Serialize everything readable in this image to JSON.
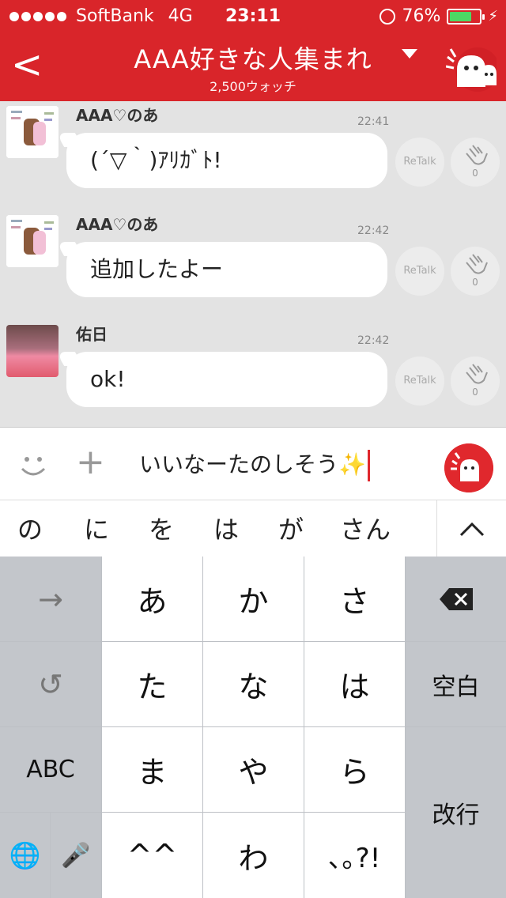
{
  "status": {
    "carrier": "SoftBank",
    "network": "4G",
    "time": "23:11",
    "battery": "76%",
    "battery_level": 0.76
  },
  "header": {
    "back_glyph": "<",
    "title": "AAA好きな人集まれ",
    "subtitle": "2,500ウォッチ"
  },
  "messages": [
    {
      "sender": "AAA♡のあ",
      "time": "22:41",
      "text": "(´▽｀)ｱﾘｶﾞﾄ!",
      "retalk": "ReTalk",
      "claps": "0"
    },
    {
      "sender": "AAA♡のあ",
      "time": "22:42",
      "text": "追加したよー",
      "retalk": "ReTalk",
      "claps": "0"
    },
    {
      "sender": "佑日",
      "time": "22:42",
      "text": "ok!",
      "retalk": "ReTalk",
      "claps": "0"
    }
  ],
  "input": {
    "text": "いいなーたのしそう✨",
    "plus_glyph": "+"
  },
  "candidates": [
    "の",
    "に",
    "を",
    "は",
    "が",
    "さん"
  ],
  "keyboard": {
    "row1": [
      "→",
      "あ",
      "か",
      "さ",
      "⌫"
    ],
    "row2": [
      "↺",
      "た",
      "な",
      "は",
      "空白"
    ],
    "row3": [
      "ABC",
      "ま",
      "や",
      "ら",
      "改行"
    ],
    "row4": [
      "🌐",
      "🎤",
      "^^",
      "わ",
      "､｡?!"
    ]
  },
  "colors": {
    "brand_red": "#d9252a",
    "battery_green": "#4cd964"
  }
}
